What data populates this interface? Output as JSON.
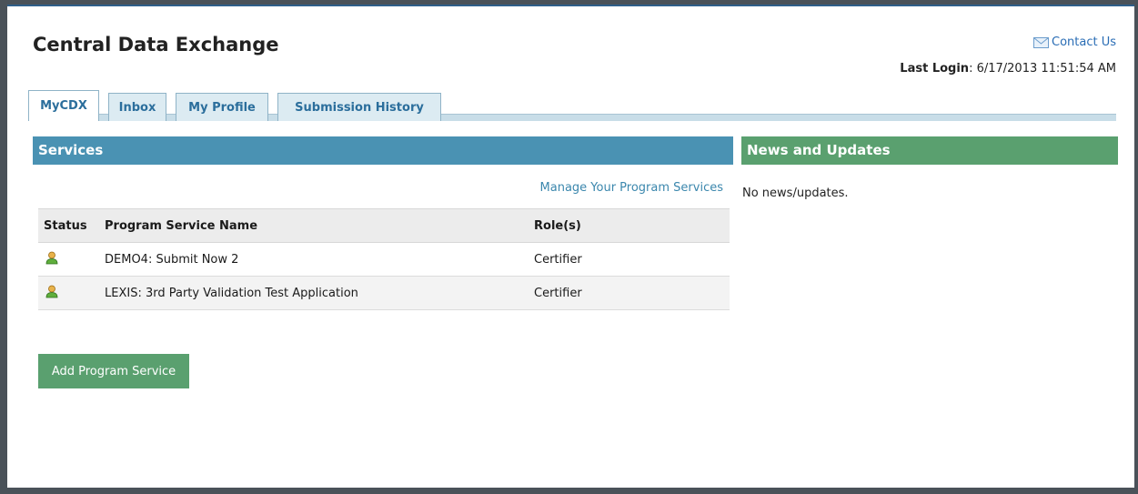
{
  "header": {
    "title": "Central Data Exchange",
    "contact_label": "Contact Us",
    "last_login_label": "Last Login",
    "last_login_value": ": 6/17/2013 11:51:54 AM"
  },
  "tabs": [
    {
      "label": "MyCDX",
      "active": true
    },
    {
      "label": "Inbox",
      "active": false
    },
    {
      "label": "My Profile",
      "active": false
    },
    {
      "label": "Submission History",
      "active": false
    }
  ],
  "services": {
    "heading": "Services",
    "manage_link": "Manage Your Program Services",
    "columns": [
      "Status",
      "Program Service Name",
      "Role(s)"
    ],
    "rows": [
      {
        "status_icon": "user-active-icon",
        "name": "DEMO4: Submit Now 2",
        "role": "Certifier"
      },
      {
        "status_icon": "user-active-icon",
        "name": "LEXIS: 3rd Party Validation Test Application",
        "role": "Certifier"
      }
    ],
    "add_button": "Add Program Service"
  },
  "news": {
    "heading": "News and Updates",
    "empty_text": "No news/updates."
  },
  "colors": {
    "services_header": "#4a92b3",
    "news_header": "#5aa06f",
    "button": "#5aa06f",
    "link": "#2a6db5"
  }
}
